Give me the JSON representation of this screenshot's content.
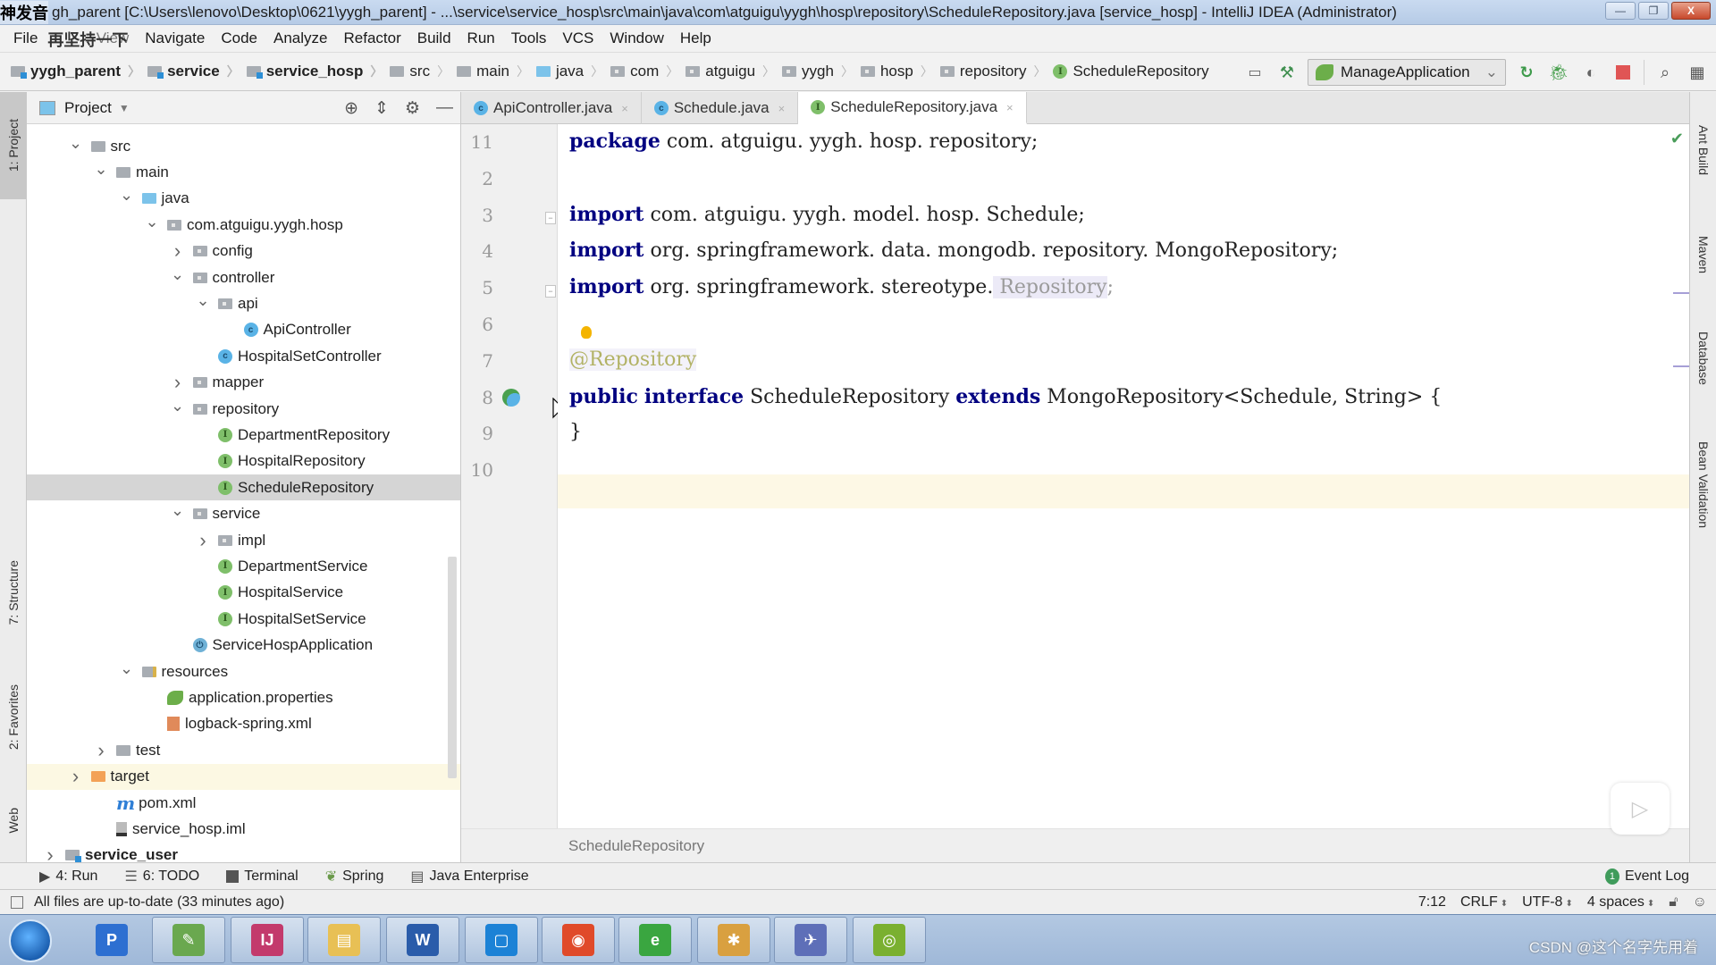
{
  "window": {
    "overlay_caption_1": "神发音",
    "title": "gh_parent [C:\\Users\\lenovo\\Desktop\\0621\\yygh_parent] - ...\\service\\service_hosp\\src\\main\\java\\com\\atguigu\\yygh\\hosp\\repository\\ScheduleRepository.java [service_hosp] - IntelliJ IDEA (Administrator)",
    "minimize": "—",
    "restore": "❐",
    "close": "X"
  },
  "menu": {
    "overlay_caption_2": "再坚持一下",
    "items": [
      "File",
      "Edit",
      "View",
      "Navigate",
      "Code",
      "Analyze",
      "Refactor",
      "Build",
      "Run",
      "Tools",
      "VCS",
      "Window",
      "Help"
    ]
  },
  "breadcrumbs": [
    {
      "label": "yygh_parent",
      "icon": "module-folder"
    },
    {
      "label": "service",
      "icon": "module-folder"
    },
    {
      "label": "service_hosp",
      "icon": "module-folder"
    },
    {
      "label": "src",
      "icon": "folder"
    },
    {
      "label": "main",
      "icon": "folder"
    },
    {
      "label": "java",
      "icon": "source-folder"
    },
    {
      "label": "com",
      "icon": "package"
    },
    {
      "label": "atguigu",
      "icon": "package"
    },
    {
      "label": "yygh",
      "icon": "package"
    },
    {
      "label": "hosp",
      "icon": "package"
    },
    {
      "label": "repository",
      "icon": "package"
    },
    {
      "label": "ScheduleRepository",
      "icon": "interface"
    }
  ],
  "toolbar": {
    "run_config": "ManageApplication",
    "run_config_arrow": "⌄"
  },
  "project_panel": {
    "title": "Project",
    "tree": [
      {
        "label": "src",
        "depth": 3,
        "chevron": "down",
        "icon": "folder"
      },
      {
        "label": "main",
        "depth": 4,
        "chevron": "down",
        "icon": "folder"
      },
      {
        "label": "java",
        "depth": 5,
        "chevron": "down",
        "icon": "source-folder"
      },
      {
        "label": "com.atguigu.yygh.hosp",
        "depth": 6,
        "chevron": "down",
        "icon": "package"
      },
      {
        "label": "config",
        "depth": 7,
        "chevron": "right",
        "icon": "package"
      },
      {
        "label": "controller",
        "depth": 7,
        "chevron": "down",
        "icon": "package"
      },
      {
        "label": "api",
        "depth": 8,
        "chevron": "down",
        "icon": "package"
      },
      {
        "label": "ApiController",
        "depth": 9,
        "chevron": "none",
        "icon": "class"
      },
      {
        "label": "HospitalSetController",
        "depth": 8,
        "chevron": "none",
        "icon": "class"
      },
      {
        "label": "mapper",
        "depth": 7,
        "chevron": "right",
        "icon": "package"
      },
      {
        "label": "repository",
        "depth": 7,
        "chevron": "down",
        "icon": "package"
      },
      {
        "label": "DepartmentRepository",
        "depth": 8,
        "chevron": "none",
        "icon": "interface"
      },
      {
        "label": "HospitalRepository",
        "depth": 8,
        "chevron": "none",
        "icon": "interface"
      },
      {
        "label": "ScheduleRepository",
        "depth": 8,
        "chevron": "none",
        "icon": "interface",
        "selected": true
      },
      {
        "label": "service",
        "depth": 7,
        "chevron": "down",
        "icon": "package"
      },
      {
        "label": "impl",
        "depth": 8,
        "chevron": "right",
        "icon": "package"
      },
      {
        "label": "DepartmentService",
        "depth": 8,
        "chevron": "none",
        "icon": "interface"
      },
      {
        "label": "HospitalService",
        "depth": 8,
        "chevron": "none",
        "icon": "interface"
      },
      {
        "label": "HospitalSetService",
        "depth": 8,
        "chevron": "none",
        "icon": "interface"
      },
      {
        "label": "ServiceHospApplication",
        "depth": 7,
        "chevron": "none",
        "icon": "spring-boot-class"
      },
      {
        "label": "resources",
        "depth": 5,
        "chevron": "down",
        "icon": "resources-folder"
      },
      {
        "label": "application.properties",
        "depth": 6,
        "chevron": "none",
        "icon": "spring-properties"
      },
      {
        "label": "logback-spring.xml",
        "depth": 6,
        "chevron": "none",
        "icon": "xml-file"
      },
      {
        "label": "test",
        "depth": 4,
        "chevron": "right",
        "icon": "folder"
      },
      {
        "label": "target",
        "depth": 3,
        "chevron": "right",
        "icon": "excluded-folder",
        "excluded": true
      },
      {
        "label": "pom.xml",
        "depth": 4,
        "chevron": "none",
        "icon": "maven"
      },
      {
        "label": "service_hosp.iml",
        "depth": 4,
        "chevron": "none",
        "icon": "iml-file"
      },
      {
        "label": "service_user",
        "depth": 2,
        "chevron": "right",
        "icon": "module-folder"
      }
    ]
  },
  "editor": {
    "tabs": [
      {
        "label": "ApiController.java",
        "icon": "class",
        "active": false
      },
      {
        "label": "Schedule.java",
        "icon": "class",
        "active": false
      },
      {
        "label": "ScheduleRepository.java",
        "icon": "interface",
        "active": true
      }
    ],
    "lines": [
      {
        "num": "11",
        "tokens": [
          {
            "t": "package",
            "c": "kw"
          },
          {
            "t": " com. atguigu. yygh. hosp. repository;",
            "c": ""
          }
        ]
      },
      {
        "num": "2",
        "tokens": []
      },
      {
        "num": "3",
        "tokens": [
          {
            "t": "import",
            "c": "kw"
          },
          {
            "t": " com. atguigu. yygh. model. hosp. Schedule;",
            "c": ""
          }
        ]
      },
      {
        "num": "4",
        "tokens": [
          {
            "t": "import",
            "c": "kw"
          },
          {
            "t": " org. springframework. data. mongodb. repository. MongoRepository;",
            "c": ""
          }
        ]
      },
      {
        "num": "5",
        "tokens": [
          {
            "t": "import",
            "c": "kw"
          },
          {
            "t": " org. springframework. stereotype.",
            "c": ""
          },
          {
            "t": " Repository",
            "c": "dim unused-hl"
          },
          {
            "t": ";",
            "c": "dim"
          }
        ]
      },
      {
        "num": "6",
        "tokens": []
      },
      {
        "num": "7",
        "tokens": [
          {
            "t": "@Repository",
            "c": "annot unused-hl"
          }
        ]
      },
      {
        "num": "8",
        "tokens": [
          {
            "t": "public",
            "c": "kw"
          },
          {
            "t": " ",
            "c": ""
          },
          {
            "t": "interface",
            "c": "kw"
          },
          {
            "t": " ScheduleRepository ",
            "c": ""
          },
          {
            "t": "extends",
            "c": "kw"
          },
          {
            "t": " MongoRepository<Schedule, String> {",
            "c": ""
          }
        ]
      },
      {
        "num": "9",
        "tokens": [
          {
            "t": "}",
            "c": ""
          }
        ]
      },
      {
        "num": "10",
        "tokens": []
      }
    ],
    "footer_breadcrumb": "ScheduleRepository"
  },
  "left_stripe": [
    "1: Project",
    "7: Structure",
    "2: Favorites",
    "Web"
  ],
  "right_stripe": [
    "Ant Build",
    "Maven",
    "Database",
    "Bean Validation"
  ],
  "bottom_tools": [
    {
      "label": "4: Run",
      "icon": "run-icon"
    },
    {
      "label": "6: TODO",
      "icon": "todo-icon"
    },
    {
      "label": "Terminal",
      "icon": "terminal-icon"
    },
    {
      "label": "Spring",
      "icon": "spring-icon"
    },
    {
      "label": "Java Enterprise",
      "icon": "java-enterprise-icon"
    }
  ],
  "event_log": {
    "label": "Event Log",
    "count": "1"
  },
  "status": {
    "message": "All files are up-to-date (33 minutes ago)",
    "caret": "7:12",
    "line_separator": "CRLF",
    "encoding": "UTF-8",
    "indent": "4 spaces"
  },
  "taskbar": {
    "apps": [
      "PP",
      "Notepad++",
      "IntelliJ IDEA",
      "Explorer",
      "Word",
      "VirtualBox",
      "Browser",
      "IE",
      "Paint",
      "MySQL",
      "App"
    ],
    "watermark": "CSDN @这个名字先用着"
  },
  "colors": {
    "keyword": "#000080",
    "selection": "#d5d5d5",
    "caret_line": "#fdf8e5",
    "interface_icon": "#7fbf6a",
    "class_icon": "#5ab3e6"
  }
}
